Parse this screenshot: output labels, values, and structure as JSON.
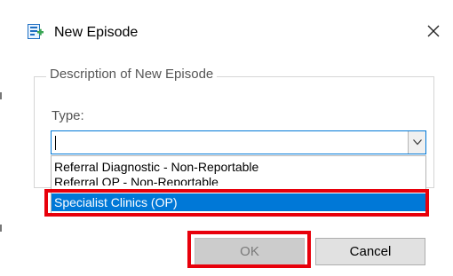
{
  "window": {
    "title": "New Episode",
    "close_glyph": "✕"
  },
  "group": {
    "legend": "Description of New Episode"
  },
  "type_field": {
    "label": "Type:",
    "value": ""
  },
  "dropdown": {
    "items": [
      "Referral Diagnostic - Non-Reportable",
      "Referral OP - Non-Reportable",
      "Specialist Clinics (OP)"
    ],
    "selected_index": 2
  },
  "buttons": {
    "ok_label": "OK",
    "cancel_label": "Cancel"
  },
  "colors": {
    "accent": "#0078d7",
    "highlight": "#e8000b",
    "icon_green": "#3aa655",
    "icon_blue": "#1e6fc2"
  },
  "icons": {
    "title": "new-episode-icon",
    "close": "close-icon",
    "dropdown": "chevron-down-icon"
  }
}
